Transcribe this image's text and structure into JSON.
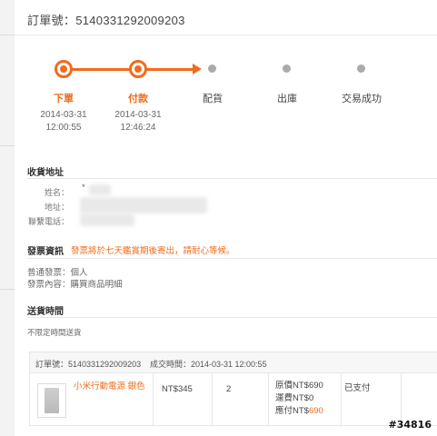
{
  "order": {
    "title": "訂單號：5140331292009203"
  },
  "progress": {
    "steps": [
      {
        "label": "下單",
        "date": "2014-03-31",
        "time": "12:00:55",
        "done": true
      },
      {
        "label": "付款",
        "date": "2014-03-31",
        "time": "12:46:24",
        "done": true
      },
      {
        "label": "配貨",
        "done": false
      },
      {
        "label": "出庫",
        "done": false
      },
      {
        "label": "交易成功",
        "done": false
      }
    ]
  },
  "address": {
    "heading": "收貨地址",
    "name_label": "姓名：",
    "address_label": "地址：",
    "phone_label": "聯繫電話：",
    "name_value": "*"
  },
  "invoice": {
    "heading": "發票資訊",
    "notice": "發票將於七天鑑賞期後寄出，請耐心等候。",
    "type_line": "普通發票：個人",
    "content_line": "發票內容：購買商品明細"
  },
  "delivery": {
    "heading": "送貨時間",
    "value": "不限定時間送貨"
  },
  "table": {
    "order_no": "訂單號：5140331292009203",
    "deal_time": "成交時間：2014-03-31 12:00:55",
    "product_name": "小米行動電源 銀色",
    "unit_price": "NT$345",
    "quantity": "2",
    "original_price": "原價NT$690",
    "shipping": "運費NT$0",
    "paid_prefix": "應付NT$",
    "paid_amount": "690",
    "status": "已支付"
  },
  "watermark": "#34816",
  "colors": {
    "accent": "#f06b1c",
    "pending": "#aaaaaa"
  }
}
